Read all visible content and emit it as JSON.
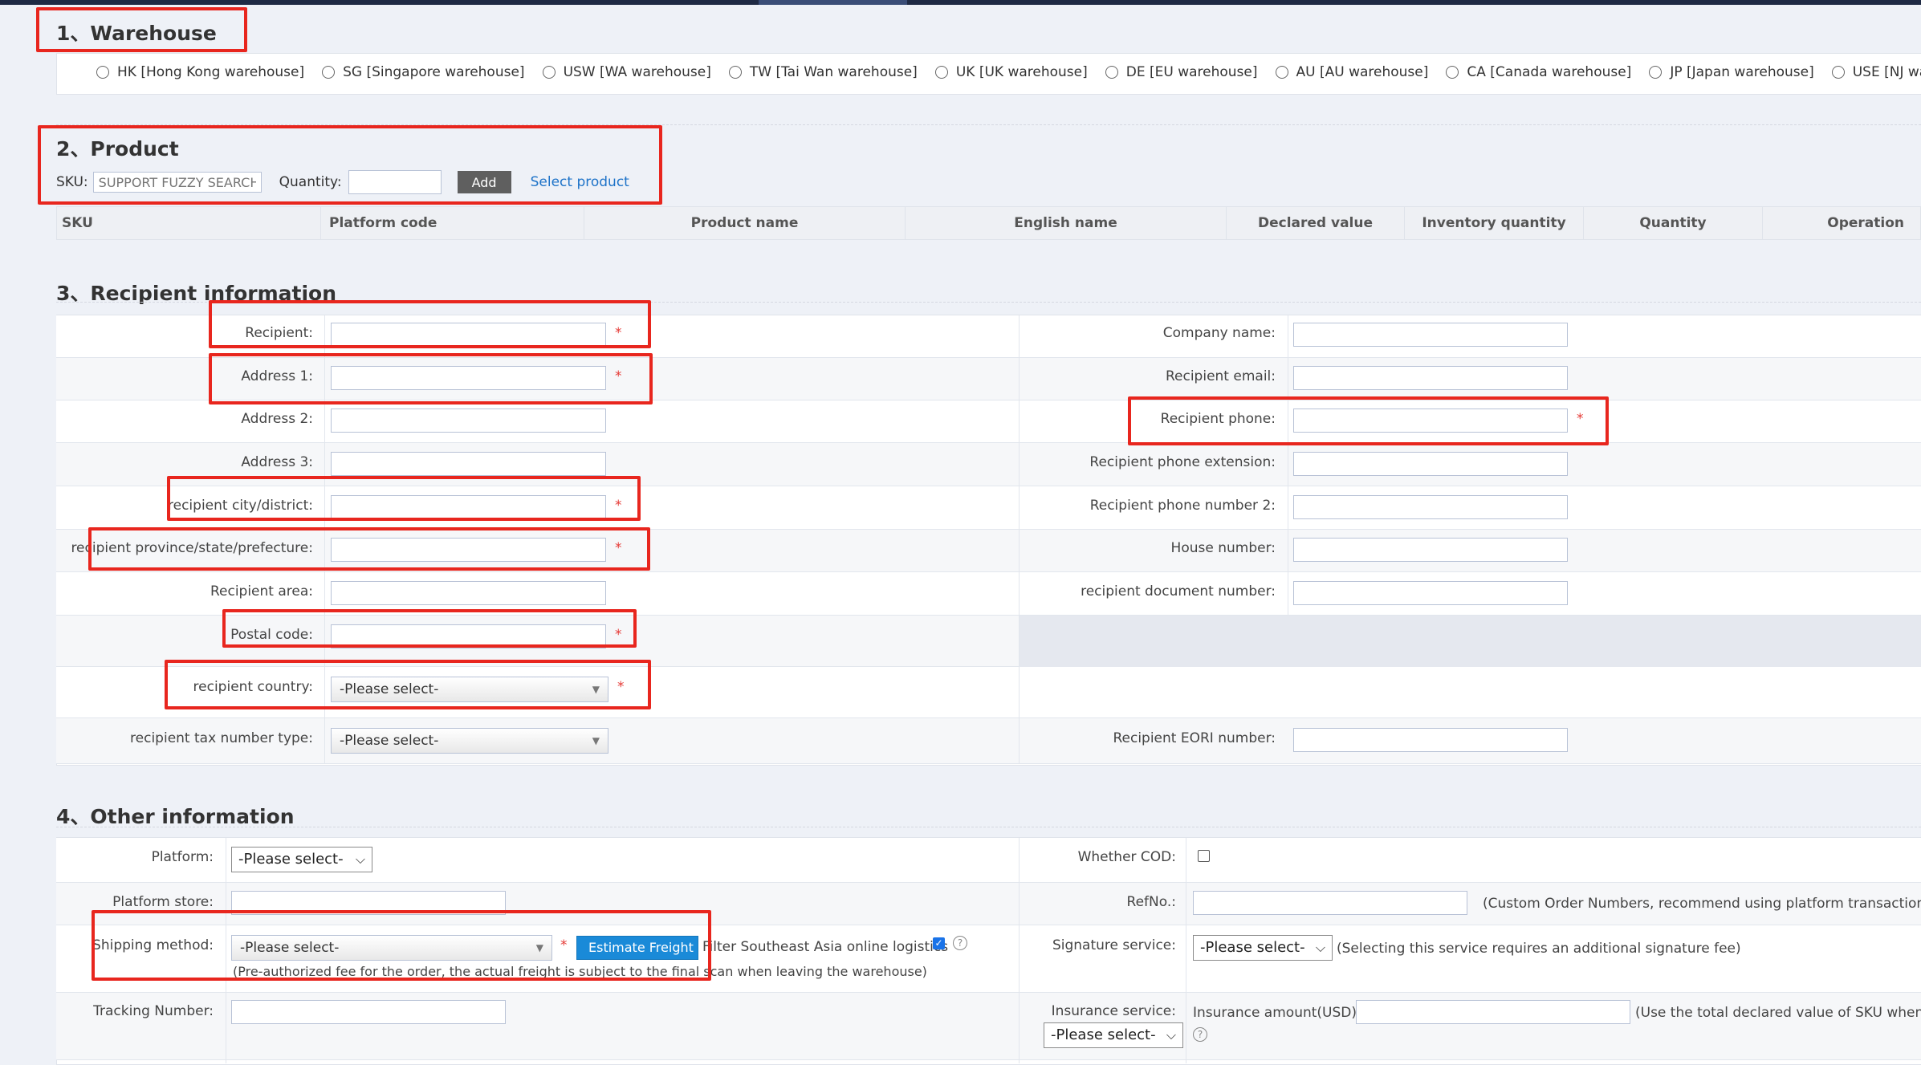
{
  "sections": {
    "warehouse": "1、Warehouse",
    "product": "2、Product",
    "recipient": "3、Recipient information",
    "other": "4、Other information"
  },
  "warehouses": [
    "HK [Hong Kong warehouse]",
    "SG [Singapore warehouse]",
    "USW [WA warehouse]",
    "TW [Tai Wan warehouse]",
    "UK [UK warehouse]",
    "DE [EU warehouse]",
    "AU [AU warehouse]",
    "CA [Canada warehouse]",
    "JP [Japan warehouse]",
    "USE [NJ warehouse]"
  ],
  "product": {
    "sku_label": "SKU:",
    "sku_placeholder": "SUPPORT FUZZY SEARCH",
    "quantity_label": "Quantity:",
    "add_button": "Add",
    "select_link": "Select product",
    "columns": [
      "SKU",
      "Platform code",
      "Product name",
      "English name",
      "Declared value",
      "Inventory quantity",
      "Quantity",
      "Operation"
    ]
  },
  "recipient": {
    "left": {
      "recipient": "Recipient:",
      "address1": "Address 1:",
      "address2": "Address 2:",
      "address3": "Address 3:",
      "city": "recipient city/district:",
      "province": "recipient province/state/prefecture:",
      "area": "Recipient area:",
      "postal": "Postal code:",
      "country": "recipient country:",
      "tax_type": "recipient tax number type:"
    },
    "right": {
      "company": "Company name:",
      "email": "Recipient email:",
      "phone": "Recipient phone:",
      "phone_ext": "Recipient phone extension:",
      "phone2": "Recipient phone number 2:",
      "house": "House number:",
      "doc": "recipient document number:",
      "eori": "Recipient EORI number:"
    },
    "required_mark": "*",
    "please_select": "-Please select-"
  },
  "other": {
    "platform": "Platform:",
    "platform_store": "Platform store:",
    "shipping": "Shipping method:",
    "tracking": "Tracking Number:",
    "cod": "Whether COD:",
    "refno": "RefNo.:",
    "refno_note": "(Custom Order Numbers, recommend using platform transaction IDs.)",
    "signature": "Signature service:",
    "signature_note": "(Selecting this service requires an additional signature fee)",
    "insurance": "Insurance service:",
    "insurance_amount": "Insurance amount(USD):",
    "insurance_note": "(Use the total declared value of SKU when emp",
    "estimate_button": "Estimate Freight",
    "filter_sea": "Filter Southeast Asia online logistics",
    "freight_note": "(Pre-authorized fee for the order, the actual freight is subject to the final scan when leaving the warehouse)",
    "help_glyph": "?"
  }
}
